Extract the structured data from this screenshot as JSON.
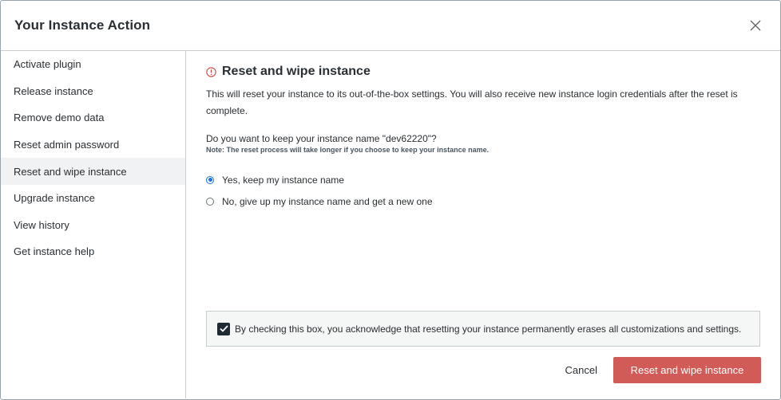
{
  "dialog": {
    "title": "Your Instance Action"
  },
  "sidebar": {
    "items": [
      {
        "label": "Activate plugin"
      },
      {
        "label": "Release instance"
      },
      {
        "label": "Remove demo data"
      },
      {
        "label": "Reset admin password"
      },
      {
        "label": "Reset and wipe instance",
        "active": true
      },
      {
        "label": "Upgrade instance"
      },
      {
        "label": "View history"
      },
      {
        "label": "Get instance help"
      }
    ]
  },
  "main": {
    "section_title": "Reset and wipe instance",
    "description": "This will reset your instance to its out-of-the-box settings. You will also receive new instance login credentials after the reset is complete.",
    "question": "Do you want to keep your instance name \"dev62220\"?",
    "note": "Note: The reset process will take longer if you choose to keep your instance name.",
    "options": [
      {
        "label": "Yes, keep my instance name",
        "selected": true
      },
      {
        "label": "No, give up my instance name and get a new one",
        "selected": false
      }
    ],
    "acknowledge": {
      "checked": true,
      "label": "By checking this box, you acknowledge that resetting your instance permanently erases all customizations and settings."
    }
  },
  "footer": {
    "cancel_label": "Cancel",
    "primary_label": "Reset and wipe instance"
  },
  "colors": {
    "primary": "#d15b57",
    "warning_icon": "#d0443f",
    "radio_selected": "#1a73e8"
  },
  "icons": {
    "close": "close-icon",
    "warning": "warning-circle-icon",
    "checkbox": "checkmark-icon"
  }
}
